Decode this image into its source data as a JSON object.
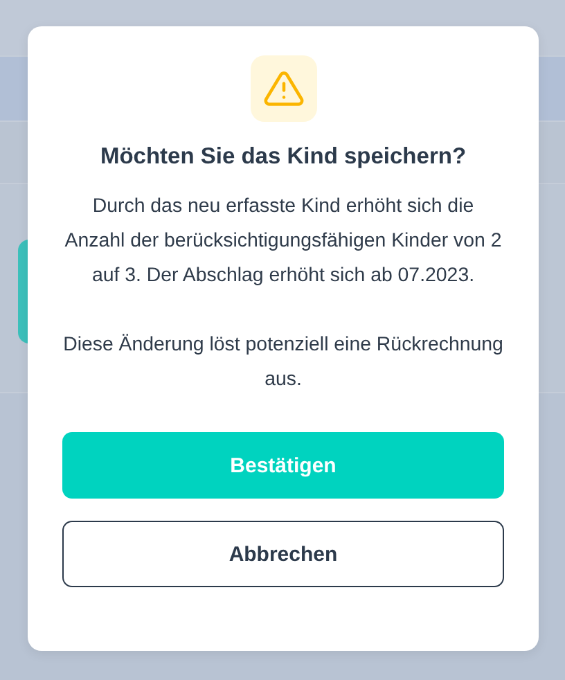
{
  "dialog": {
    "title": "Möchten Sie das Kind speichern?",
    "paragraphs": [
      "Durch das neu erfasste Kind erhöht sich die Anzahl der berücksichtigungsfähigen Kinder von 2 auf 3. Der Abschlag erhöht sich ab 07.2023.",
      "Diese Änderung löst potenziell eine Rückrechnung aus."
    ],
    "buttons": [
      {
        "label": "Bestätigen",
        "kind": "primary"
      },
      {
        "label": "Abbrechen",
        "kind": "secondary"
      }
    ]
  }
}
